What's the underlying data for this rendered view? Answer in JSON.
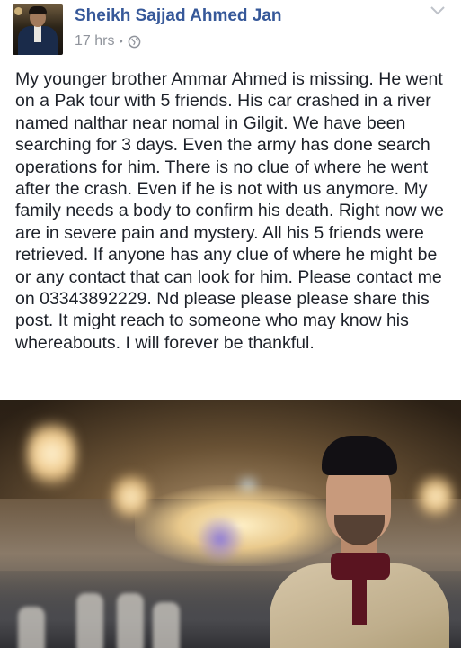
{
  "post": {
    "author": "Sheikh Sajjad Ahmed Jan",
    "timestamp": "17 hrs",
    "separator": "•",
    "audience_icon": "globe-icon",
    "menu_icon": "chevron-down-icon",
    "text": "My younger brother Ammar Ahmed is missing. He went on a Pak tour with 5 friends. His car crashed in a river named nalthar near nomal in Gilgit. We have been searching for 3 days. Even the army has done search operations for him. There is no clue of where he went after the crash. Even if he is not with us anymore. My family needs a body to confirm his death. Right now we are in severe pain and mystery. All his 5 friends were retrieved. If anyone has any clue of where he might be or any contact that can look for him. Please contact me on 03343892229. Nd please please please share this post. It might reach to someone who may know his whereabouts. I will forever be thankful."
  },
  "colors": {
    "author": "#365899",
    "meta": "#90949c",
    "text": "#1d2129"
  }
}
